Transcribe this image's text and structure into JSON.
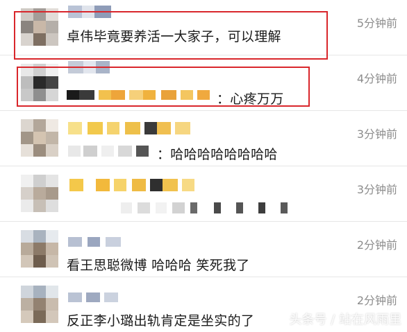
{
  "comments": [
    {
      "text": "卓伟毕竟要养活一大家子，可以理解",
      "time": "5分钟前"
    },
    {
      "text": "：心疼万万",
      "time": "4分钟前"
    },
    {
      "text": "：哈哈哈哈哈哈哈哈",
      "time": "3分钟前"
    },
    {
      "text": "",
      "time": "3分钟前"
    },
    {
      "text": "看王思聪微博 哈哈哈 笑死我了",
      "time": "2分钟前"
    },
    {
      "text": "反正李小璐出轨肯定是坐实的了",
      "time": "2分钟前"
    }
  ],
  "watermark": "头条号 / 站在风雨里",
  "colors": {
    "highlight": "#d9262b",
    "timestamp": "#8c8c8c",
    "text": "#1a1a1a"
  }
}
